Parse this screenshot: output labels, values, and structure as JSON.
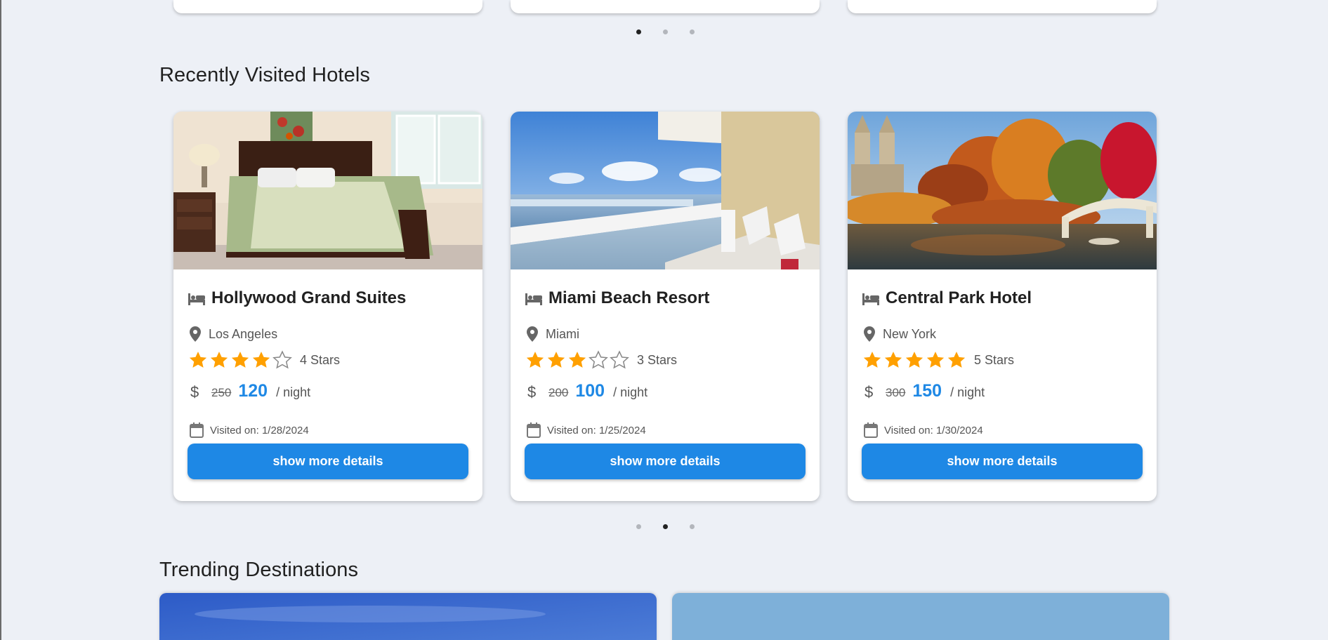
{
  "recently_visited": {
    "title": "Recently Visited Hotels",
    "hotels": [
      {
        "name": "Hollywood Grand Suites",
        "location": "Los Angeles",
        "stars": 4,
        "stars_label": "4 Stars",
        "old_price": "250",
        "new_price": "120",
        "per_night": "/ night",
        "visited": "Visited on: 1/28/2024",
        "button": "show more details",
        "image_icon": "bedroom-photo"
      },
      {
        "name": "Miami Beach Resort",
        "location": "Miami",
        "stars": 3,
        "stars_label": "3 Stars",
        "old_price": "200",
        "new_price": "100",
        "per_night": "/ night",
        "visited": "Visited on: 1/25/2024",
        "button": "show more details",
        "image_icon": "balcony-ocean-photo"
      },
      {
        "name": "Central Park Hotel",
        "location": "New York",
        "stars": 5,
        "stars_label": "5 Stars",
        "old_price": "300",
        "new_price": "150",
        "per_night": "/ night",
        "visited": "Visited on: 1/30/2024",
        "button": "show more details",
        "image_icon": "central-park-photo"
      }
    ]
  },
  "trending": {
    "title": "Trending Destinations"
  },
  "colors": {
    "accent": "#1e88e5",
    "star": "#ffa000",
    "background": "#edf0f6"
  },
  "carousel_top": {
    "active_index": 0,
    "count": 3
  },
  "carousel_hotels": {
    "active_index": 1,
    "count": 3
  }
}
